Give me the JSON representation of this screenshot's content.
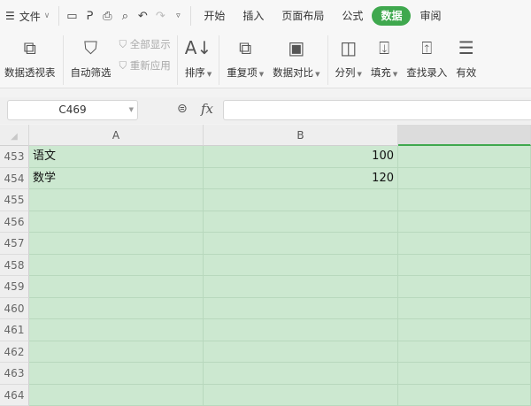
{
  "menu": {
    "file": "文件",
    "tabs": [
      "开始",
      "插入",
      "页面布局",
      "公式",
      "数据",
      "审阅"
    ],
    "active_tab": "数据"
  },
  "ribbon": {
    "pivot": "数据透视表",
    "autofilter": "自动筛选",
    "show_all": "全部显示",
    "reapply": "重新应用",
    "sort": "排序",
    "duplicates": "重复项",
    "compare": "数据对比",
    "split": "分列",
    "fill": "填充",
    "lookup": "查找录入",
    "validity": "有效"
  },
  "formula_bar": {
    "name_box": "C469",
    "fx": "fx",
    "value": ""
  },
  "columns": [
    "A",
    "B",
    ""
  ],
  "rows": [
    {
      "n": "453",
      "a": "语文",
      "b": "100"
    },
    {
      "n": "454",
      "a": "数学",
      "b": "120"
    },
    {
      "n": "455",
      "a": "",
      "b": ""
    },
    {
      "n": "456",
      "a": "",
      "b": ""
    },
    {
      "n": "457",
      "a": "",
      "b": ""
    },
    {
      "n": "458",
      "a": "",
      "b": ""
    },
    {
      "n": "459",
      "a": "",
      "b": ""
    },
    {
      "n": "460",
      "a": "",
      "b": ""
    },
    {
      "n": "461",
      "a": "",
      "b": ""
    },
    {
      "n": "462",
      "a": "",
      "b": ""
    },
    {
      "n": "463",
      "a": "",
      "b": ""
    },
    {
      "n": "464",
      "a": "",
      "b": ""
    }
  ]
}
